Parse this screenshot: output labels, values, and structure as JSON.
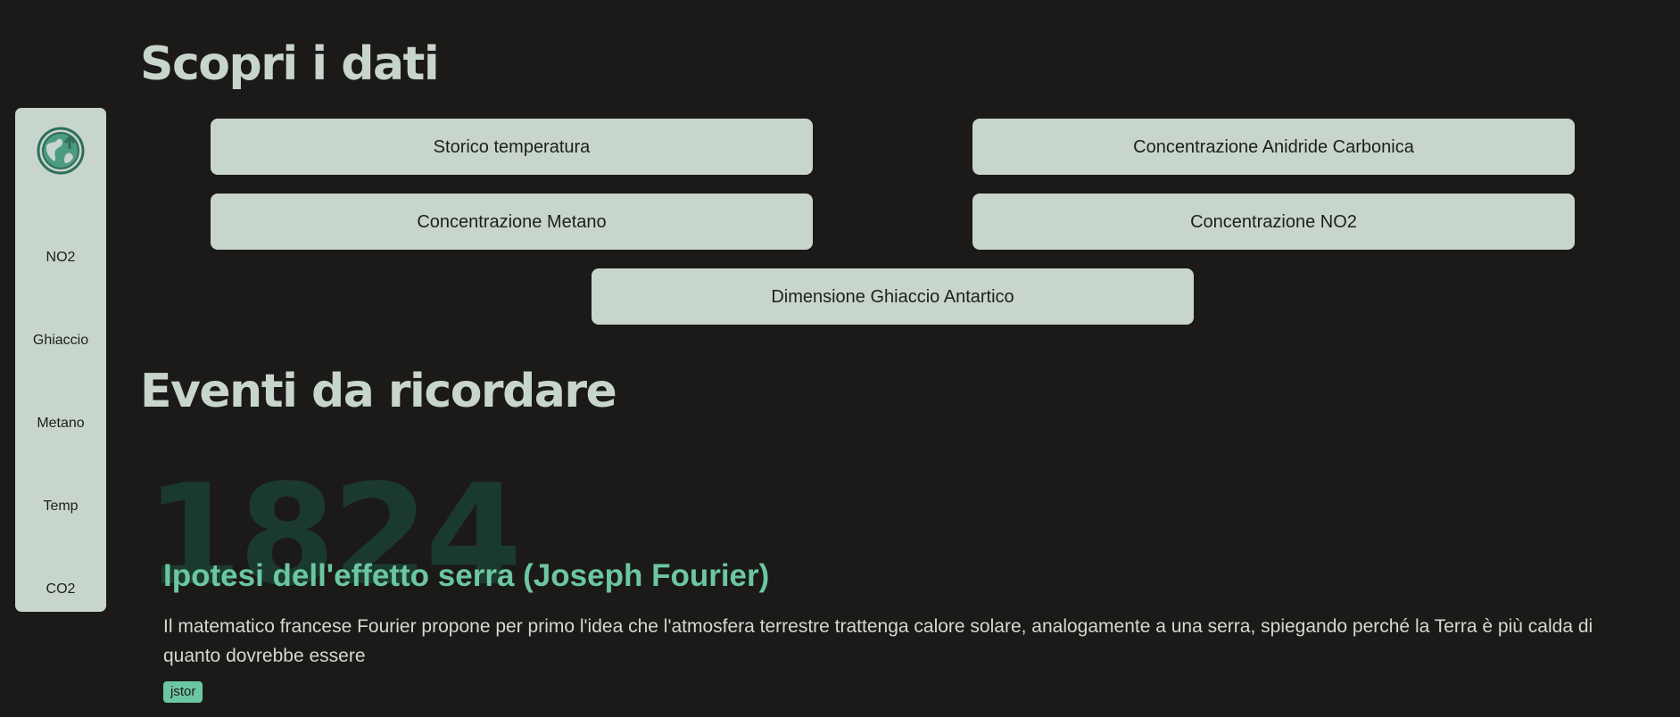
{
  "sidebar": {
    "logo_icon": "earth-globe-arrow-icon",
    "items": [
      {
        "label": "NO2"
      },
      {
        "label": "Ghiaccio"
      },
      {
        "label": "Metano"
      },
      {
        "label": "Temp"
      },
      {
        "label": "CO2"
      }
    ]
  },
  "data_section": {
    "title": "Scopri i dati",
    "buttons": [
      {
        "label": "Storico temperatura"
      },
      {
        "label": "Concentrazione Anidride Carbonica"
      },
      {
        "label": "Concentrazione Metano"
      },
      {
        "label": "Concentrazione NO2"
      },
      {
        "label": "Dimensione Ghiaccio Antartico"
      }
    ]
  },
  "events_section": {
    "title": "Eventi da ricordare",
    "events": [
      {
        "year": "1824",
        "title": "Ipotesi dell'effetto serra (Joseph Fourier)",
        "description": "Il matematico francese Fourier propone per primo l'idea che l'atmosfera terrestre trattenga calore solare, analogamente a una serra, spiegando perché la Terra è più calda di quanto dovrebbe essere",
        "source": "jstor"
      }
    ]
  },
  "colors": {
    "background": "#1b1a19",
    "panel": "#c8d5cc",
    "accent": "#6cc6a2",
    "year_watermark": "#1b3a2f"
  }
}
